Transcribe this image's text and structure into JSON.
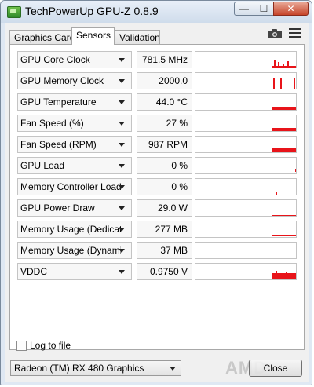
{
  "window": {
    "title": "TechPowerUp GPU-Z 0.8.9",
    "caption": {
      "minimize": "—",
      "maximize": "☐",
      "close": "✕"
    }
  },
  "tabs": [
    {
      "label": "Graphics Card",
      "active": false
    },
    {
      "label": "Sensors",
      "active": true
    },
    {
      "label": "Validation",
      "active": false
    }
  ],
  "toolbar": {
    "camera_icon": "camera-icon",
    "menu_icon": "hamburger-menu-icon"
  },
  "sensors": [
    {
      "label": "GPU Core Clock",
      "value": "781.5 MHz"
    },
    {
      "label": "GPU Memory Clock",
      "value": "2000.0 MHz"
    },
    {
      "label": "GPU Temperature",
      "value": "44.0 °C"
    },
    {
      "label": "Fan Speed (%)",
      "value": "27 %"
    },
    {
      "label": "Fan Speed (RPM)",
      "value": "987 RPM"
    },
    {
      "label": "GPU Load",
      "value": "0 %"
    },
    {
      "label": "Memory Controller Load",
      "value": "0 %"
    },
    {
      "label": "GPU Power Draw",
      "value": "29.0 W"
    },
    {
      "label": "Memory Usage (Dedicated)",
      "value": "277 MB"
    },
    {
      "label": "Memory Usage (Dynamic)",
      "value": "37 MB"
    },
    {
      "label": "VDDC",
      "value": "0.9750 V"
    }
  ],
  "graph_color": "#e8141a",
  "footer": {
    "log_label": "Log to file",
    "log_checked": false,
    "gpu_selected": "Radeon (TM) RX 480 Graphics",
    "brand_logo": "AMD",
    "close_label": "Close"
  }
}
